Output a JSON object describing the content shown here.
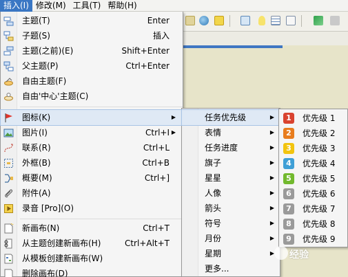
{
  "menubar": {
    "items": [
      {
        "label": "插入(I)",
        "active": true
      },
      {
        "label": "修改(M)",
        "active": false
      },
      {
        "label": "工具(T)",
        "active": false
      },
      {
        "label": "帮助(H)",
        "active": false
      }
    ]
  },
  "insert_menu": {
    "items": [
      {
        "label": "主题(T)",
        "shortcut": "Enter",
        "icon": "topic-icon"
      },
      {
        "label": "子题(S)",
        "shortcut": "插入",
        "icon": "subtopic-icon"
      },
      {
        "label": "主题(之前)(E)",
        "shortcut": "Shift+Enter",
        "icon": "topic-before-icon"
      },
      {
        "label": "父主题(P)",
        "shortcut": "Ctrl+Enter",
        "icon": "parent-topic-icon"
      },
      {
        "label": "自由主题(F)",
        "shortcut": "",
        "icon": "floating-topic-icon"
      },
      {
        "label": "自由'中心'主题(C)",
        "shortcut": "",
        "icon": "floating-central-topic-icon"
      },
      {
        "label": "图标(K)",
        "shortcut": "",
        "icon": "flag-icon",
        "submenu": true,
        "highlighted": true
      },
      {
        "label": "图片(I)",
        "shortcut": "Ctrl+I",
        "icon": "image-icon",
        "submenu": true
      },
      {
        "label": "联系(R)",
        "shortcut": "Ctrl+L",
        "icon": "relationship-icon"
      },
      {
        "label": "外框(B)",
        "shortcut": "Ctrl+B",
        "icon": "boundary-icon"
      },
      {
        "label": "概要(M)",
        "shortcut": "Ctrl+]",
        "icon": "summary-icon"
      },
      {
        "label": "附件(A)",
        "shortcut": "",
        "icon": "paperclip-icon"
      },
      {
        "label": "录音 [Pro](O)",
        "shortcut": "",
        "icon": "record-icon"
      },
      {
        "label": "新画布(N)",
        "shortcut": "Ctrl+T",
        "icon": "new-sheet-icon"
      },
      {
        "label": "从主题创建新画布(H)",
        "shortcut": "Ctrl+Alt+T",
        "icon": "sheet-from-topic-icon"
      },
      {
        "label": "从模板创建新画布(W)",
        "shortcut": "",
        "icon": "sheet-from-template-icon"
      },
      {
        "label": "删除画布(D)",
        "shortcut": "",
        "icon": "delete-sheet-icon"
      }
    ]
  },
  "marker_menu": {
    "items": [
      {
        "label": "任务优先级",
        "highlighted": true
      },
      {
        "label": "表情"
      },
      {
        "label": "任务进度"
      },
      {
        "label": "旗子"
      },
      {
        "label": "星星"
      },
      {
        "label": "人像"
      },
      {
        "label": "箭头"
      },
      {
        "label": "符号"
      },
      {
        "label": "月份"
      },
      {
        "label": "星期"
      },
      {
        "label": "更多..."
      }
    ]
  },
  "priority_menu": {
    "items": [
      {
        "num": "1",
        "label": "优先级 1",
        "color": "#d9432f"
      },
      {
        "num": "2",
        "label": "优先级 2",
        "color": "#e87d1e"
      },
      {
        "num": "3",
        "label": "优先级 3",
        "color": "#f2c40f"
      },
      {
        "num": "4",
        "label": "优先级 4",
        "color": "#3f9fd6"
      },
      {
        "num": "5",
        "label": "优先级 5",
        "color": "#72b92e"
      },
      {
        "num": "6",
        "label": "优先级 6",
        "color": "#9a9a9a"
      },
      {
        "num": "7",
        "label": "优先级 7",
        "color": "#9a9a9a"
      },
      {
        "num": "8",
        "label": "优先级 8",
        "color": "#9a9a9a"
      },
      {
        "num": "9",
        "label": "优先级 9",
        "color": "#9a9a9a"
      }
    ]
  },
  "watermark": {
    "text": "经验"
  }
}
